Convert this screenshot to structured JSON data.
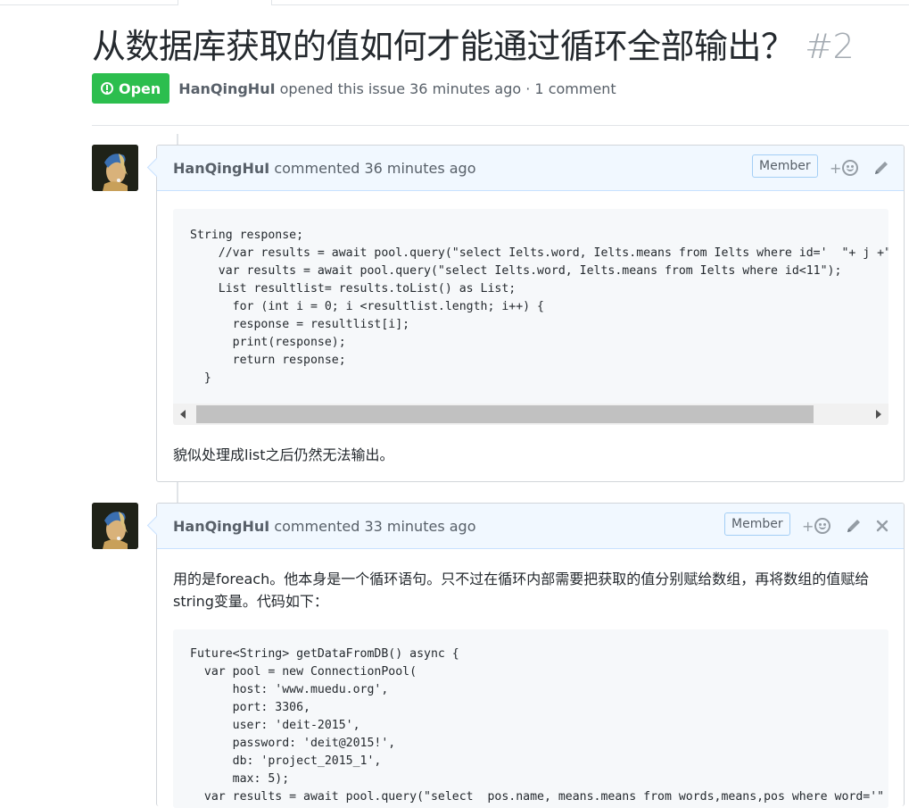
{
  "issue": {
    "title": "从数据库获取的值如何才能通过循环全部输出？",
    "number": "#2",
    "state": "Open",
    "author": "HanQingHuI",
    "opened_text": " opened this issue 36 minutes ago · 1 comment"
  },
  "comments": [
    {
      "author": "HanQingHuI",
      "meta": " commented 36 minutes ago",
      "badge": "Member",
      "code": "String response;\n    //var results = await pool.query(\"select Ielts.word, Ielts.means from Ielts where id='  \"+ j +\"\n    var results = await pool.query(\"select Ielts.word, Ielts.means from Ielts where id<11\");\n    List resultlist= results.toList() as List;\n      for (int i = 0; i <resultlist.length; i++) {\n      response = resultlist[i];\n      print(response);\n      return response;\n  }",
      "text": "貌似处理成list之后仍然无法输出。"
    },
    {
      "author": "HanQingHuI",
      "meta": " commented 33 minutes ago",
      "badge": "Member",
      "text": "用的是foreach。他本身是一个循环语句。只不过在循环内部需要把获取的值分别赋给数组，再将数组的值赋给string变量。代码如下：",
      "code": "Future<String> getDataFromDB() async {\n  var pool = new ConnectionPool(\n      host: 'www.muedu.org',\n      port: 3306,\n      user: 'deit-2015',\n      password: 'deit@2015!',\n      db: 'project_2015_1',\n      max: 5);\n  var results = await pool.query(\"select  pos.name, means.means from words,means,pos where word='\" +"
    }
  ],
  "icons": {
    "reaction": "smiley-icon",
    "edit": "pencil-icon",
    "delete": "close-icon",
    "state": "issue-opened-icon"
  },
  "colors": {
    "open_green": "#2cbe4e",
    "comment_header_bg": "#f1f8ff",
    "muted_text": "#586069"
  }
}
